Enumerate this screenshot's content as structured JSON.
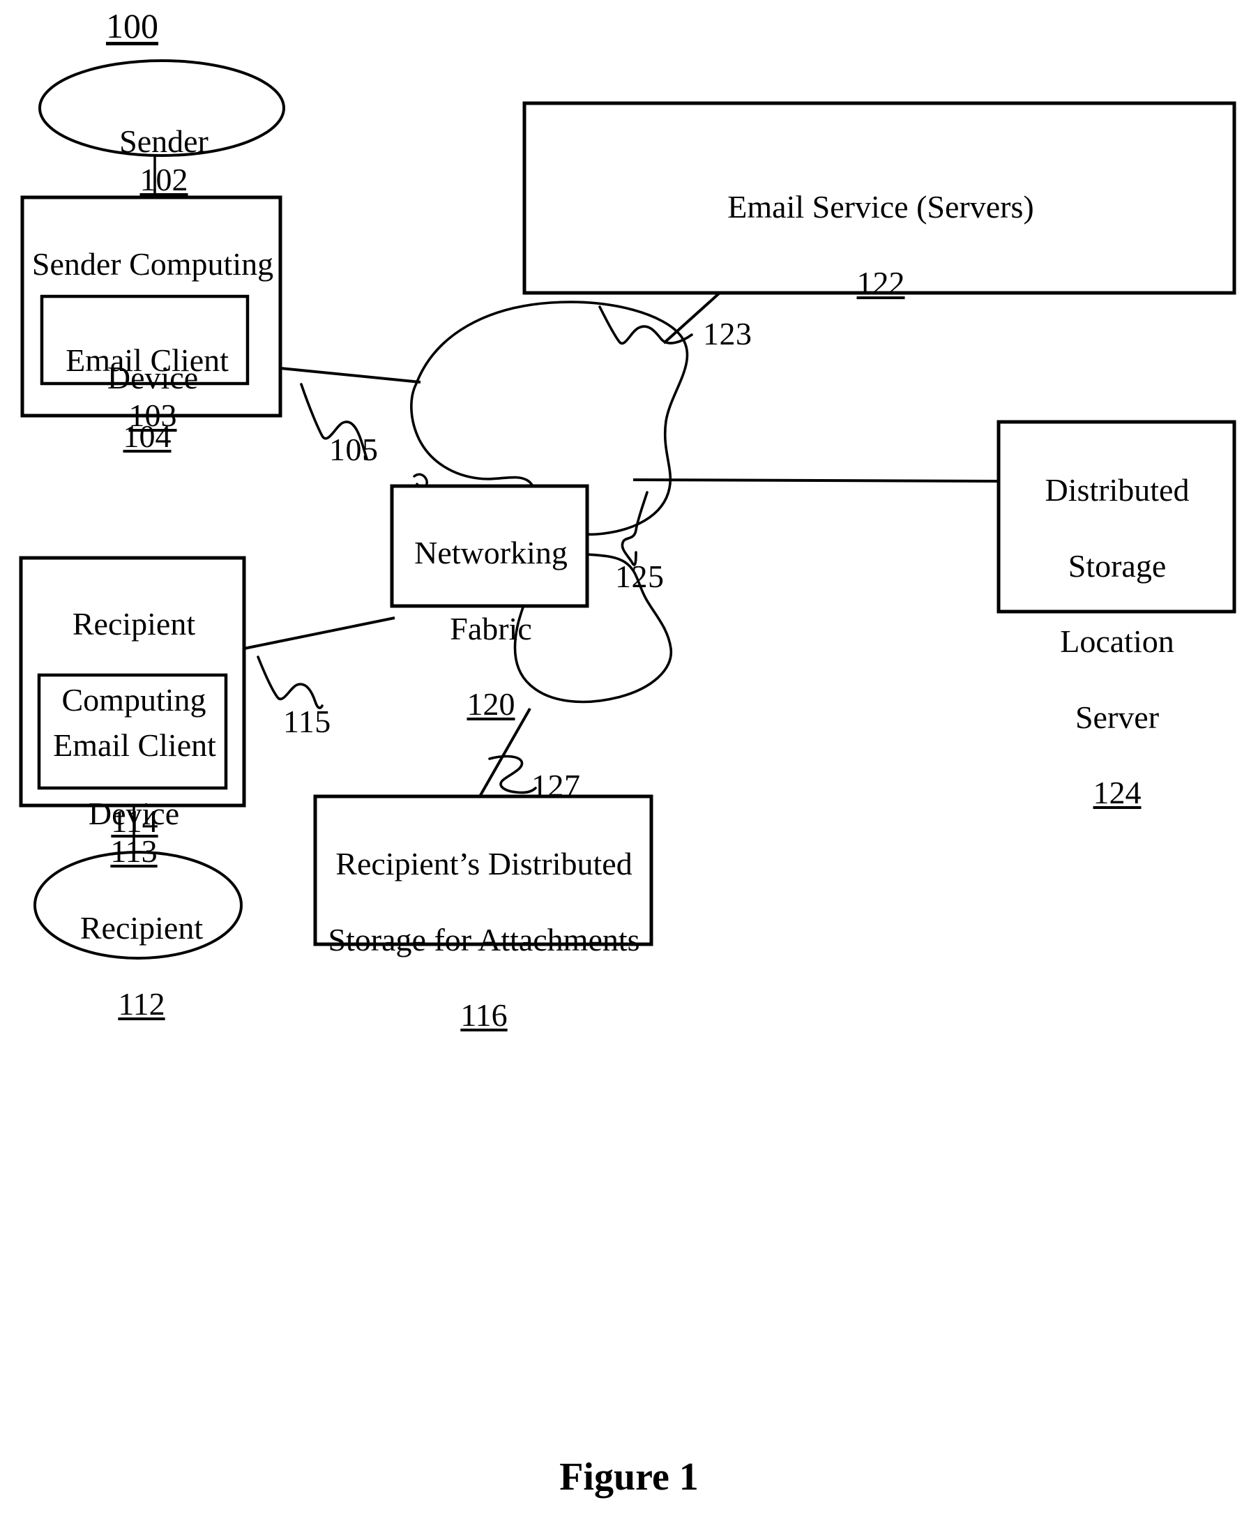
{
  "figure": {
    "system_ref": "100",
    "caption": "Figure 1"
  },
  "nodes": {
    "sender": {
      "name": "Sender",
      "ref": "102",
      "shape": "ellipse"
    },
    "sender_computing_device": {
      "line1": "Sender Computing",
      "line2": "Device",
      "ref": "103",
      "shape": "rect"
    },
    "sender_email_client": {
      "name": "Email Client",
      "ref": "104",
      "shape": "rect"
    },
    "email_service": {
      "name": "Email Service (Servers)",
      "ref": "122",
      "shape": "rect"
    },
    "distributed_storage_location_server": {
      "line1": "Distributed",
      "line2": "Storage",
      "line3": "Location",
      "line4": "Server",
      "ref": "124",
      "shape": "rect"
    },
    "networking_fabric": {
      "line1": "Networking",
      "line2": "Fabric",
      "ref": "120",
      "shape": "rect"
    },
    "recipient_computing_device": {
      "line1": "Recipient",
      "line2": "Computing",
      "line3": "Device",
      "ref": "113",
      "shape": "rect"
    },
    "recipient_email_client": {
      "name": "Email Client",
      "ref": "114",
      "shape": "rect"
    },
    "recipient": {
      "name": "Recipient",
      "ref": "112",
      "shape": "ellipse"
    },
    "recipient_distributed_storage": {
      "line1": "Recipient’s Distributed",
      "line2": "Storage for Attachments",
      "ref": "116",
      "shape": "rect"
    }
  },
  "connections": [
    {
      "ref": "105",
      "from": "sender_computing_device",
      "to": "networking_fabric"
    },
    {
      "ref": "123",
      "from": "email_service",
      "to": "networking_fabric"
    },
    {
      "ref": "125",
      "from": "networking_fabric",
      "to": "distributed_storage_location_server"
    },
    {
      "ref": "115",
      "from": "recipient_computing_device",
      "to": "networking_fabric"
    },
    {
      "ref": "127",
      "from": "networking_fabric",
      "to": "recipient_distributed_storage"
    }
  ],
  "colors": {
    "stroke": "#000000",
    "background": "#ffffff"
  }
}
